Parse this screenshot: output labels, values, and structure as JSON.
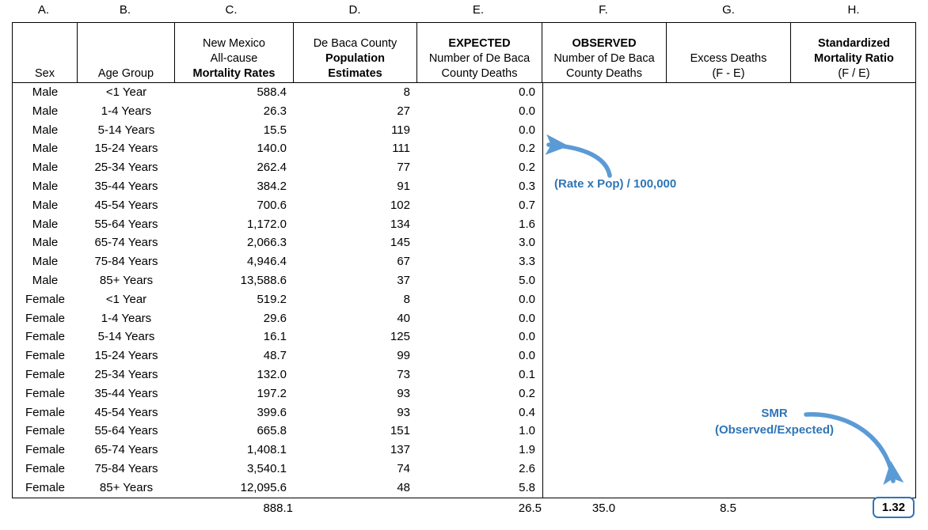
{
  "column_letters": [
    "A.",
    "B.",
    "C.",
    "D.",
    "E.",
    "F.",
    "G.",
    "H."
  ],
  "table": {
    "headers": [
      {
        "lines": [
          {
            "text": "",
            "bold": false
          },
          {
            "text": "",
            "bold": false
          },
          {
            "text": "Sex",
            "bold": false
          }
        ]
      },
      {
        "lines": [
          {
            "text": "",
            "bold": false
          },
          {
            "text": "",
            "bold": false
          },
          {
            "text": "Age Group",
            "bold": false
          }
        ]
      },
      {
        "lines": [
          {
            "text": "New Mexico",
            "bold": false
          },
          {
            "text": "All-cause",
            "bold": false
          },
          {
            "text": "Mortality Rates",
            "bold": true
          }
        ]
      },
      {
        "lines": [
          {
            "text": "De Baca County",
            "bold": false
          },
          {
            "text": "Population",
            "bold": true
          },
          {
            "text": "Estimates",
            "bold": true
          }
        ]
      },
      {
        "lines": [
          {
            "text": "EXPECTED",
            "bold": true
          },
          {
            "text": "Number of De Baca",
            "bold": false
          },
          {
            "text": "County Deaths",
            "bold": false
          }
        ]
      },
      {
        "lines": [
          {
            "text": "OBSERVED",
            "bold": true
          },
          {
            "text": "Number of De Baca",
            "bold": false
          },
          {
            "text": "County Deaths",
            "bold": false
          }
        ]
      },
      {
        "lines": [
          {
            "text": "",
            "bold": false
          },
          {
            "text": "Excess Deaths",
            "bold": false
          },
          {
            "text": "(F - E)",
            "bold": false
          }
        ]
      },
      {
        "lines": [
          {
            "text": "Standardized",
            "bold": true
          },
          {
            "text": "Mortality Ratio",
            "bold": true
          },
          {
            "text": "(F / E)",
            "bold": false
          }
        ]
      }
    ],
    "rows": [
      {
        "sex": "Male",
        "age_group": "<1 Year",
        "mortality_rate": "588.4",
        "population": "8",
        "expected": "0.0"
      },
      {
        "sex": "Male",
        "age_group": "1-4 Years",
        "mortality_rate": "26.3",
        "population": "27",
        "expected": "0.0"
      },
      {
        "sex": "Male",
        "age_group": "5-14 Years",
        "mortality_rate": "15.5",
        "population": "119",
        "expected": "0.0"
      },
      {
        "sex": "Male",
        "age_group": "15-24 Years",
        "mortality_rate": "140.0",
        "population": "111",
        "expected": "0.2"
      },
      {
        "sex": "Male",
        "age_group": "25-34 Years",
        "mortality_rate": "262.4",
        "population": "77",
        "expected": "0.2"
      },
      {
        "sex": "Male",
        "age_group": "35-44 Years",
        "mortality_rate": "384.2",
        "population": "91",
        "expected": "0.3"
      },
      {
        "sex": "Male",
        "age_group": "45-54 Years",
        "mortality_rate": "700.6",
        "population": "102",
        "expected": "0.7"
      },
      {
        "sex": "Male",
        "age_group": "55-64 Years",
        "mortality_rate": "1,172.0",
        "population": "134",
        "expected": "1.6"
      },
      {
        "sex": "Male",
        "age_group": "65-74 Years",
        "mortality_rate": "2,066.3",
        "population": "145",
        "expected": "3.0"
      },
      {
        "sex": "Male",
        "age_group": "75-84 Years",
        "mortality_rate": "4,946.4",
        "population": "67",
        "expected": "3.3"
      },
      {
        "sex": "Male",
        "age_group": "85+ Years",
        "mortality_rate": "13,588.6",
        "population": "37",
        "expected": "5.0"
      },
      {
        "sex": "Female",
        "age_group": "<1 Year",
        "mortality_rate": "519.2",
        "population": "8",
        "expected": "0.0"
      },
      {
        "sex": "Female",
        "age_group": "1-4 Years",
        "mortality_rate": "29.6",
        "population": "40",
        "expected": "0.0"
      },
      {
        "sex": "Female",
        "age_group": "5-14 Years",
        "mortality_rate": "16.1",
        "population": "125",
        "expected": "0.0"
      },
      {
        "sex": "Female",
        "age_group": "15-24 Years",
        "mortality_rate": "48.7",
        "population": "99",
        "expected": "0.0"
      },
      {
        "sex": "Female",
        "age_group": "25-34 Years",
        "mortality_rate": "132.0",
        "population": "73",
        "expected": "0.1"
      },
      {
        "sex": "Female",
        "age_group": "35-44 Years",
        "mortality_rate": "197.2",
        "population": "93",
        "expected": "0.2"
      },
      {
        "sex": "Female",
        "age_group": "45-54 Years",
        "mortality_rate": "399.6",
        "population": "93",
        "expected": "0.4"
      },
      {
        "sex": "Female",
        "age_group": "55-64 Years",
        "mortality_rate": "665.8",
        "population": "151",
        "expected": "1.0"
      },
      {
        "sex": "Female",
        "age_group": "65-74 Years",
        "mortality_rate": "1,408.1",
        "population": "137",
        "expected": "1.9"
      },
      {
        "sex": "Female",
        "age_group": "75-84 Years",
        "mortality_rate": "3,540.1",
        "population": "74",
        "expected": "2.6"
      },
      {
        "sex": "Female",
        "age_group": "85+ Years",
        "mortality_rate": "12,095.6",
        "population": "48",
        "expected": "5.8"
      }
    ],
    "totals": {
      "mortality_rate": "888.1",
      "expected": "26.5",
      "observed": "35.0",
      "excess_deaths": "8.5",
      "smr": "1.32"
    }
  },
  "annotations": {
    "expected_formula": "(Rate x Pop) / 100,000",
    "smr_title": "SMR",
    "smr_subtitle": "(Observed/Expected)"
  },
  "colors": {
    "accent_blue": "#2E75B6",
    "arrow_blue": "#5B9BD5",
    "table_border": "#000000",
    "text": "#000000"
  }
}
